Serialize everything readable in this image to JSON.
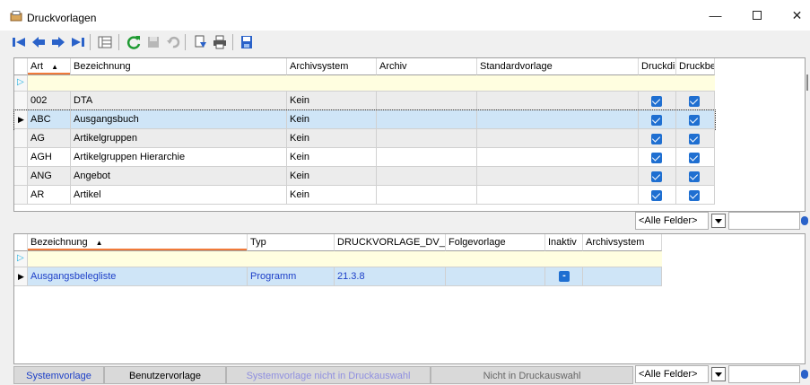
{
  "window": {
    "title": "Druckvorlagen"
  },
  "colors": {
    "selected_row": "#cfe5f7",
    "alt_row": "#ececec",
    "new_row": "#fffee0",
    "sort_line": "#f07a3a",
    "checkbox": "#1f6fd1",
    "legend_disabled_text": "#8f8fe0",
    "legend_program_text": "#1e40c8"
  },
  "toolbar": {
    "icons": [
      "first-icon",
      "prev-icon",
      "next-icon",
      "last-icon",
      "list-view-icon",
      "refresh-icon",
      "save-icon",
      "undo-icon",
      "import-icon",
      "print-icon",
      "floppy-icon"
    ]
  },
  "top_grid": {
    "columns": [
      "Art",
      "Bezeichnung",
      "Archivsystem",
      "Archiv",
      "Standardvorlage",
      "Druckdi",
      "Druckbe"
    ],
    "rows": [
      {
        "art": "002",
        "bezeichnung": "DTA",
        "archivsystem": "Kein",
        "archiv": "",
        "standardvorlage": "",
        "c1": true,
        "c2": true
      },
      {
        "art": "ABC",
        "bezeichnung": "Ausgangsbuch",
        "archivsystem": "Kein",
        "archiv": "",
        "standardvorlage": "",
        "c1": true,
        "c2": true
      },
      {
        "art": "AG",
        "bezeichnung": "Artikelgruppen",
        "archivsystem": "Kein",
        "archiv": "",
        "standardvorlage": "",
        "c1": true,
        "c2": true
      },
      {
        "art": "AGH",
        "bezeichnung": "Artikelgruppen Hierarchie",
        "archivsystem": "Kein",
        "archiv": "",
        "standardvorlage": "",
        "c1": true,
        "c2": true
      },
      {
        "art": "ANG",
        "bezeichnung": "Angebot",
        "archivsystem": "Kein",
        "archiv": "",
        "standardvorlage": "",
        "c1": true,
        "c2": true
      },
      {
        "art": "AR",
        "bezeichnung": "Artikel",
        "archivsystem": "Kein",
        "archiv": "",
        "standardvorlage": "",
        "c1": true,
        "c2": true
      }
    ],
    "filter": "<Alle Felder>"
  },
  "bottom_grid": {
    "columns": [
      "Bezeichnung",
      "Typ",
      "DRUCKVORLAGE_DV_F",
      "Folgevorlage",
      "Inaktiv",
      "Archivsystem"
    ],
    "rows": [
      {
        "bezeichnung": "Ausgangsbelegliste",
        "typ": "Programm",
        "dv": "21.3.8",
        "folgevorlage": "",
        "inaktiv": "-",
        "archivsystem": ""
      }
    ]
  },
  "legend": {
    "items": [
      "Systemvorlage",
      "Benutzervorlage",
      "Systemvorlage nicht in Druckauswahl",
      "Nicht in Druckauswahl"
    ],
    "filter": "<Alle Felder>"
  }
}
